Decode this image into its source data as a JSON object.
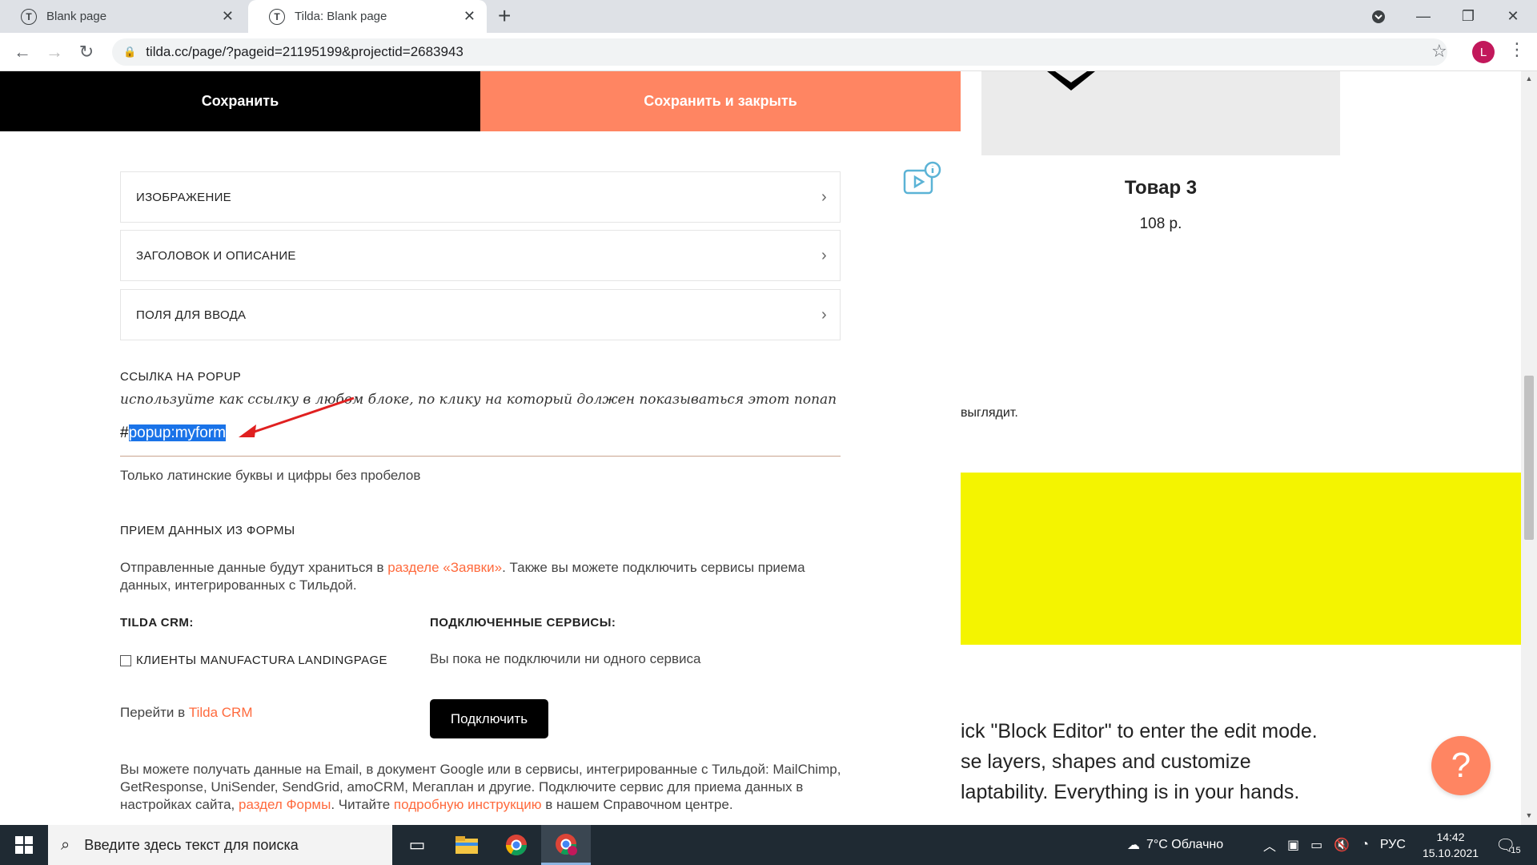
{
  "browser": {
    "tabs": [
      {
        "title": "Blank page",
        "favicon": "T",
        "active": false
      },
      {
        "title": "Tilda: Blank page",
        "favicon": "T",
        "active": true
      }
    ],
    "url": "tilda.cc/page/?pageid=21195199&projectid=2683943",
    "profile_initial": "L"
  },
  "editor": {
    "save_label": "Сохранить",
    "save_close_label": "Сохранить и закрыть",
    "sections": [
      {
        "label": "ИЗОБРАЖЕНИЕ"
      },
      {
        "label": "ЗАГОЛОВОК И ОПИСАНИЕ"
      },
      {
        "label": "ПОЛЯ ДЛЯ ВВОДА"
      }
    ],
    "popup_link": {
      "title": "ССЫЛКА НА POPUP",
      "hint": "используйте как ссылку в любом блоке, по клику на который должен показываться этот попап",
      "prefix": "#",
      "value": "popup:myform",
      "note": "Только латинские буквы и цифры без пробелов"
    },
    "form_data": {
      "title": "ПРИЕМ ДАННЫХ ИЗ ФОРМЫ",
      "desc_part1": "Отправленные данные будут храниться в ",
      "desc_link": "разделе «Заявки»",
      "desc_part2": ". Также вы можете подключить сервисы приема данных, интегрированных с Тильдой.",
      "crm_title": "TILDA CRM:",
      "crm_checkbox": "КЛИЕНТЫ MANUFACTURA LANDINGPAGE",
      "crm_goto": "Перейти в ",
      "crm_link": "Tilda CRM",
      "services_title": "ПОДКЛЮЧЕННЫЕ СЕРВИСЫ:",
      "services_empty": "Вы пока не подключили ни одного сервиса",
      "connect_label": "Подключить",
      "bottom_part1": "Вы можете получать данные на Email, в документ Google или в сервисы, интегрированные с Тильдой: MailChimp, GetResponse, UniSender, SendGrid, amoCRM, Мегаплан и другие. Подключите сервис для приема данных в настройках сайта, ",
      "bottom_link1": "раздел Формы",
      "bottom_part2": ". Читайте ",
      "bottom_link2": "подробную инструкцию",
      "bottom_part3": " в нашем Справочном центре."
    }
  },
  "preview": {
    "product_title": "Товар 3",
    "product_price": "108 р.",
    "partial_text": "выглядит.",
    "big_lines": [
      "ick \"Block Editor\" to enter the edit mode.",
      "se layers, shapes and customize",
      "laptability. Everything is in your hands."
    ],
    "yellow": "#f4f400"
  },
  "taskbar": {
    "search_placeholder": "Введите здесь текст для поиска",
    "weather": "7°C  Облачно",
    "lang": "РУС",
    "time": "14:42",
    "date": "15.10.2021",
    "notifications": "15"
  },
  "colors": {
    "accent": "#ff8562",
    "link": "#ff6a3d"
  }
}
